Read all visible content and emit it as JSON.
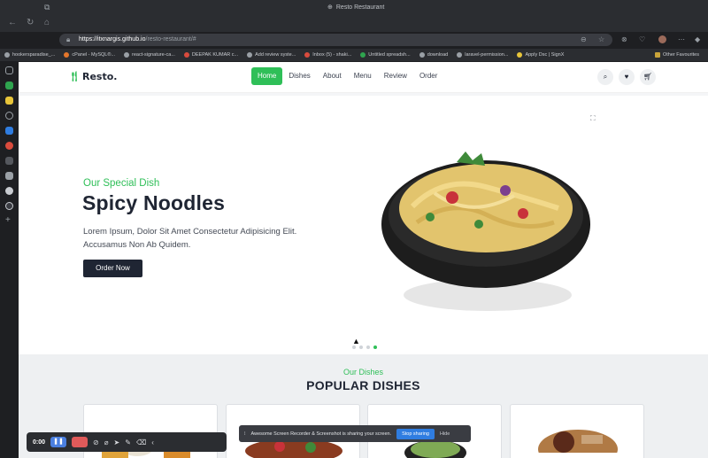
{
  "browser": {
    "tab_title": "Resto Restaurant",
    "url_host": "https://itxnargis.github.io",
    "url_path": "/resto-restaurant/#",
    "bookmarks": [
      "hookersparadise_...",
      "cPanel - MySQL®...",
      "react-signature-ca...",
      "DEEPAK KUMAR c...",
      "Add review syste...",
      "Inbox (5) - shaki...",
      "Untitled spreadsh...",
      "download",
      "laravel-permission...",
      "Apply Dsc | SignX"
    ],
    "other_bookmarks": "Other Favourites"
  },
  "site": {
    "logo": "Resto.",
    "nav": [
      "Home",
      "Dishes",
      "About",
      "Menu",
      "Review",
      "Order"
    ],
    "hero": {
      "subtitle": "Our Special Dish",
      "title": "Spicy Noodles",
      "description": "Lorem Ipsum, Dolor Sit Amet Consectetur Adipisicing Elit. Accusamus Non Ab Quidem.",
      "button": "Order Now",
      "active_slide": 4,
      "slide_count": 4
    },
    "dishes": {
      "subtitle": "Our Dishes",
      "heading": "POPULAR DISHES"
    }
  },
  "recorder": {
    "time": "0:00"
  },
  "share": {
    "message": "Awesome Screen Recorder & Screenshot is sharing your screen.",
    "stop": "Stop sharing",
    "hide": "Hide"
  },
  "colors": {
    "accent": "#2fbf58",
    "dark": "#1f2533"
  }
}
